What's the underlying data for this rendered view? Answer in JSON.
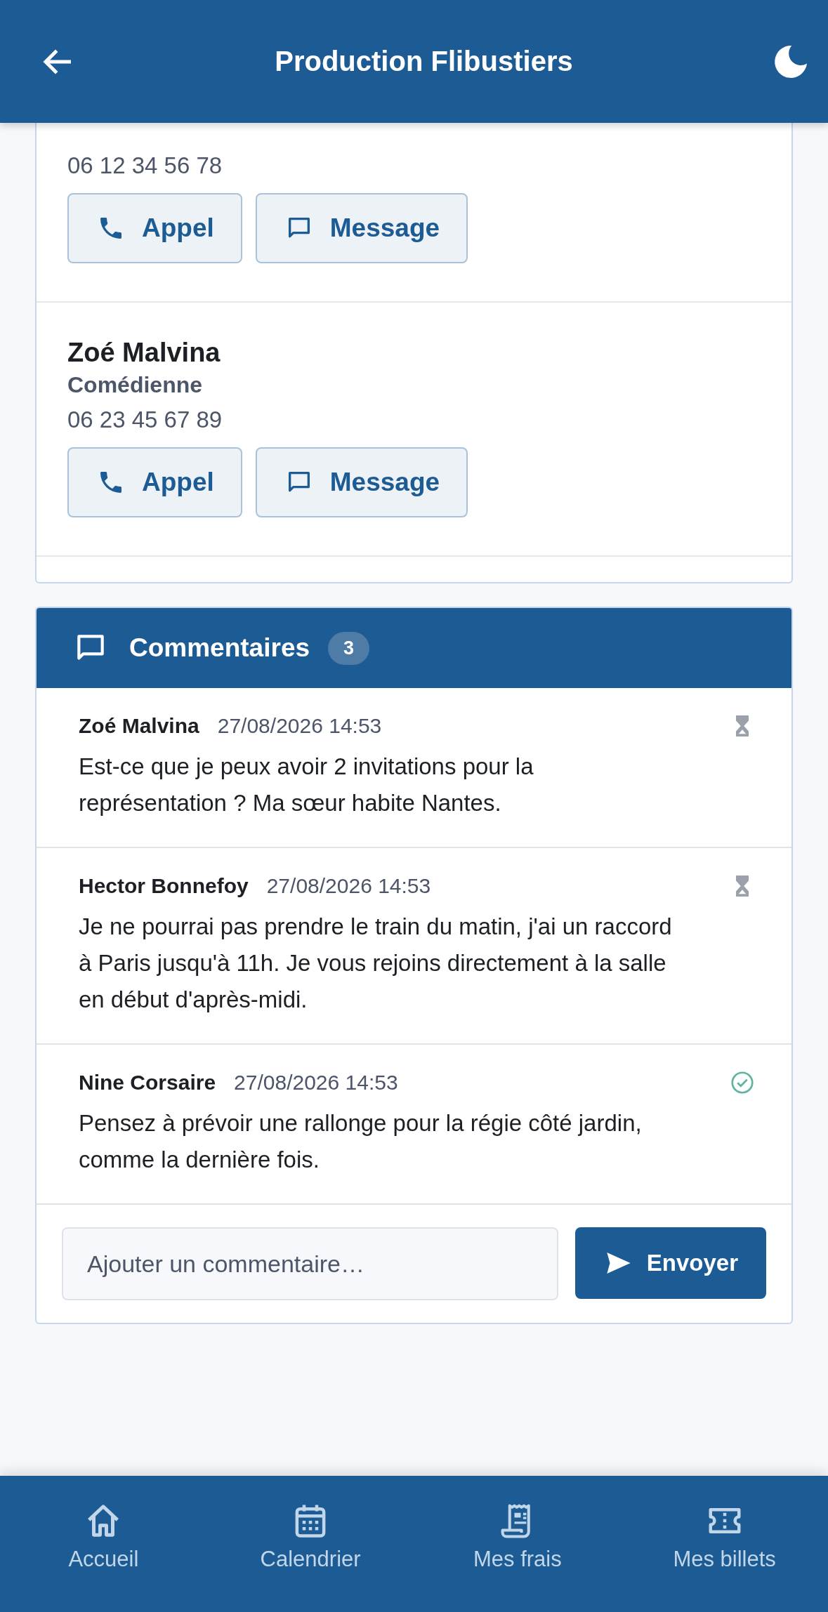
{
  "header": {
    "title": "Production Flibustiers"
  },
  "contacts": [
    {
      "phone": "06 12 34 56 78",
      "actions": [
        "Appel",
        "Message"
      ]
    },
    {
      "name": "Zoé Malvina",
      "role": "Comédienne",
      "phone": "06 23 45 67 89",
      "actions": [
        "Appel",
        "Message"
      ]
    }
  ],
  "comments": {
    "title": "Commentaires",
    "count": "3",
    "items": [
      {
        "author": "Zoé Malvina",
        "time": "27/08/2026 14:53",
        "text": "Est-ce que je peux avoir 2 invitations pour la représentation ? Ma sœur habite Nantes.",
        "approved": false
      },
      {
        "author": "Hector Bonnefoy",
        "time": "27/08/2026 14:53",
        "text": "Je ne pourrai pas prendre le train du matin, j'ai un raccord à Paris jusqu'à 11h. Je vous rejoins directement à la salle en début d'après-midi.",
        "approved": false
      },
      {
        "author": "Nine Corsaire",
        "time": "27/08/2026 14:53",
        "text": "Pensez à prévoir une rallonge pour la régie côté jardin, comme la dernière fois.",
        "approved": true
      }
    ],
    "input": {
      "placeholder": "Ajouter un commentaire…"
    },
    "send": "Envoyer"
  },
  "nav": [
    {
      "label": "Accueil",
      "kind": "home"
    },
    {
      "label": "Calendrier",
      "kind": "calendar"
    },
    {
      "label": "Mes frais",
      "kind": "receipt"
    },
    {
      "label": "Mes billets",
      "kind": "ticket"
    }
  ]
}
